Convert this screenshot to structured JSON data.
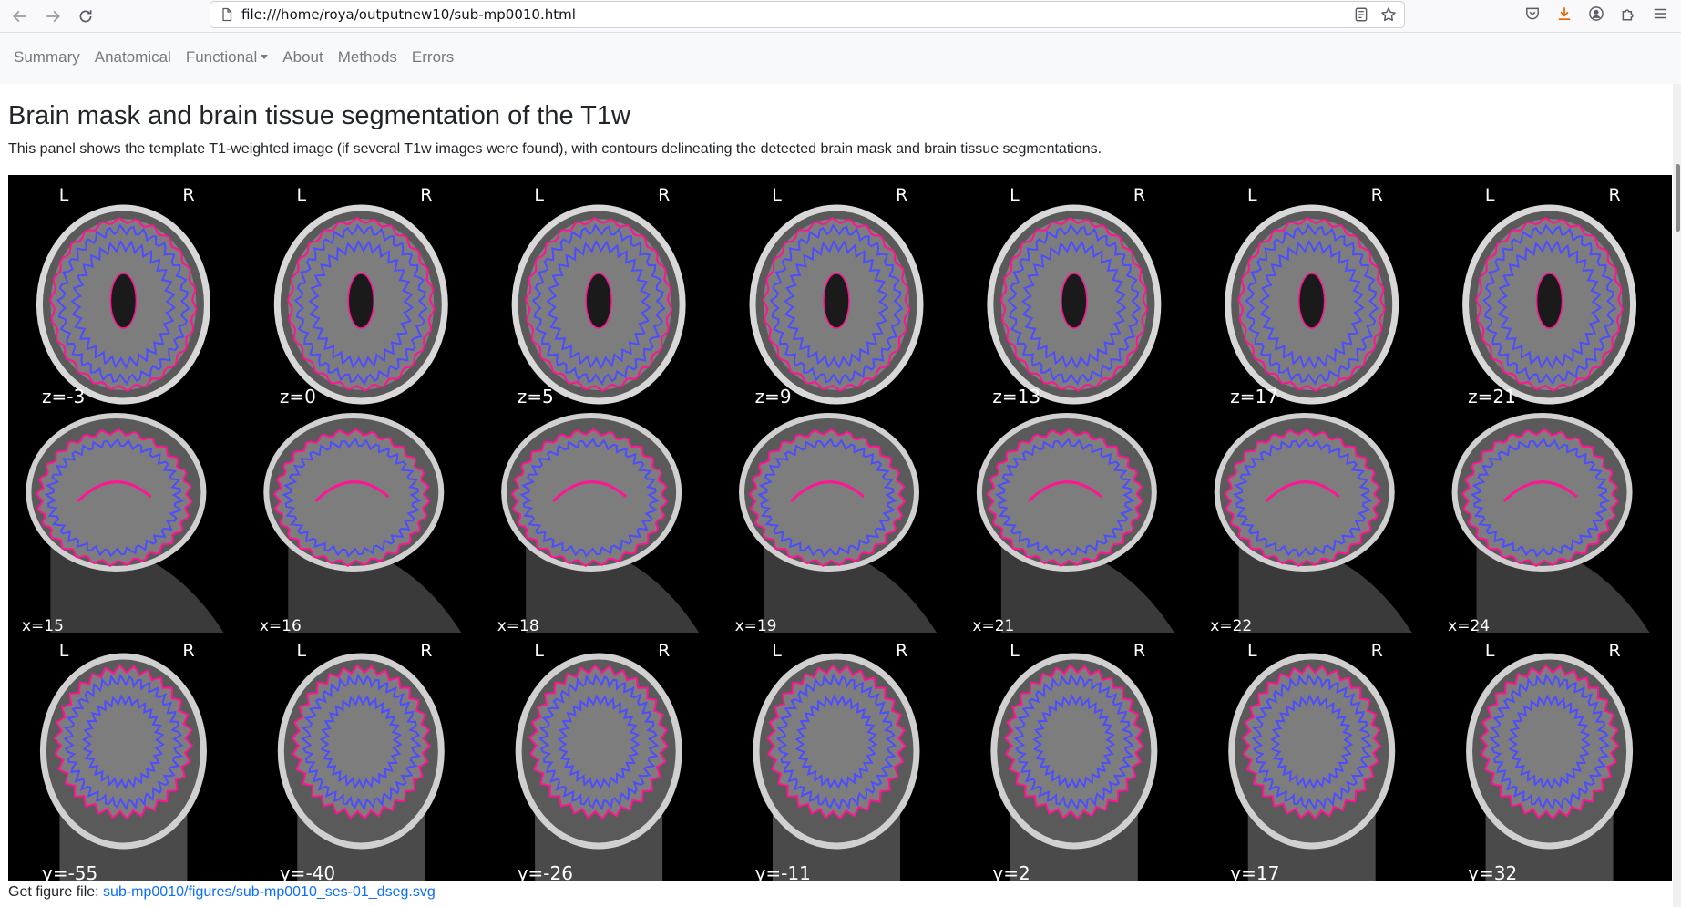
{
  "browser": {
    "url": "file:///home/roya/outputnew10/sub-mp0010.html",
    "icons": [
      "back-icon",
      "forward-icon",
      "reload-icon",
      "page-icon",
      "reader-icon",
      "bookmark-star-icon",
      "pocket-icon",
      "download-icon",
      "account-icon",
      "extensions-icon",
      "menu-icon"
    ],
    "download_color": "#e66000"
  },
  "navbar": {
    "items": [
      {
        "label": "Summary"
      },
      {
        "label": "Anatomical"
      },
      {
        "label": "Functional",
        "dropdown": true
      },
      {
        "label": "About"
      },
      {
        "label": "Methods"
      },
      {
        "label": "Errors"
      }
    ]
  },
  "section": {
    "title": "Brain mask and brain tissue segmentation of the T1w",
    "description": "This panel shows the template T1-weighted image (if several T1w images were found), with contours delineating the detected brain mask and brain tissue segmentations."
  },
  "figure": {
    "orientation_left": "L",
    "orientation_right": "R",
    "contour_colors": {
      "brain_mask": "#ff1493",
      "tissue": "#4d4dff"
    },
    "rows": [
      {
        "view": "axial",
        "slices": [
          "z=-3",
          "z=0",
          "z=5",
          "z=9",
          "z=13",
          "z=17",
          "z=21"
        ]
      },
      {
        "view": "sagittal",
        "slices": [
          "x=15",
          "x=16",
          "x=18",
          "x=19",
          "x=21",
          "x=22",
          "x=24"
        ]
      },
      {
        "view": "coronal",
        "slices": [
          "y=-55",
          "y=-40",
          "y=-26",
          "y=-11",
          "y=2",
          "y=17",
          "y=32"
        ]
      }
    ]
  },
  "figure_link": {
    "prefix": "Get figure file: ",
    "link_text": "sub-mp0010/figures/sub-mp0010_ses-01_dseg.svg"
  }
}
